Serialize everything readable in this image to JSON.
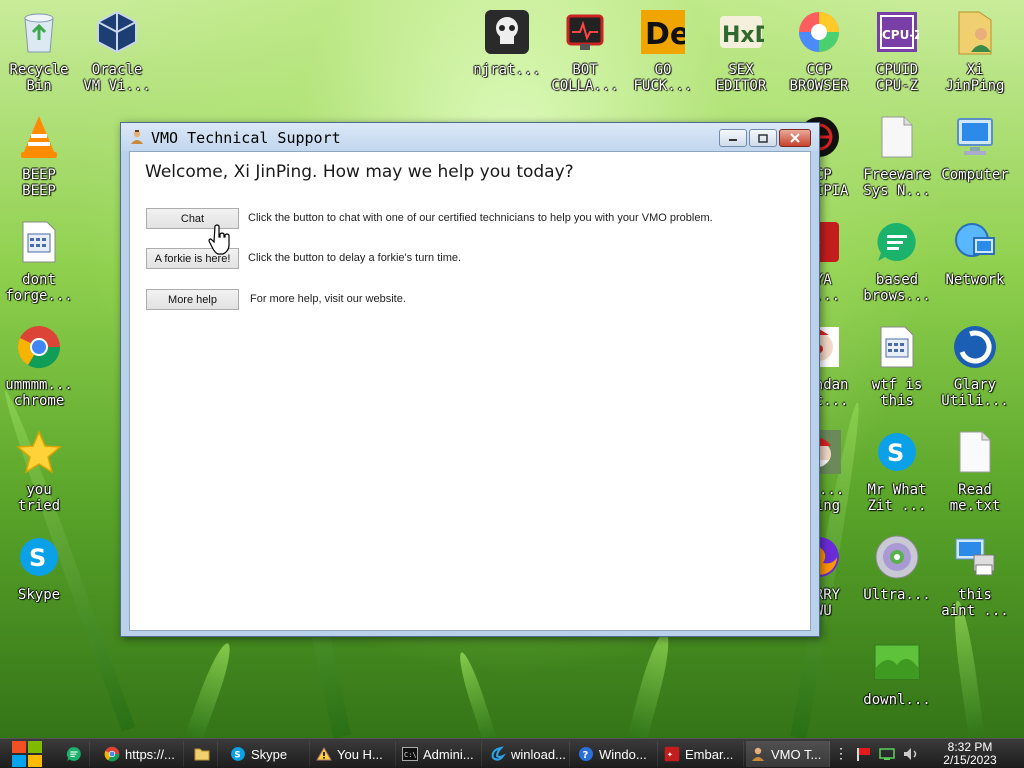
{
  "desktop": {
    "icons": [
      {
        "label": "Recycle\nBin",
        "icon": "recycle-bin-icon"
      },
      {
        "label": "Oracle\nVM Vi...",
        "icon": "virtualbox-icon"
      },
      {
        "label": "njrat...",
        "icon": "skull-icon"
      },
      {
        "label": "BOT\nCOLLA...",
        "icon": "heart-monitor-icon"
      },
      {
        "label": "GO\nFUCK...",
        "icon": "de-app-icon"
      },
      {
        "label": "SEX\nEDITOR",
        "icon": "hxd-icon"
      },
      {
        "label": "CCP\nBROWSER",
        "icon": "browser-icon"
      },
      {
        "label": "CPUID\nCPU-Z",
        "icon": "cpuz-icon"
      },
      {
        "label": "Xi\nJinPing",
        "icon": "user-folder-icon"
      },
      {
        "label": "BEEP\nBEEP",
        "icon": "vlc-icon"
      },
      {
        "label": "CCP\nWIKIPIA",
        "icon": "red-globe-icon"
      },
      {
        "label": "Freeware\nSys N...",
        "icon": "blank-document-icon"
      },
      {
        "label": "Computer",
        "icon": "computer-icon"
      },
      {
        "label": "dont\nforge...",
        "icon": "batch-file-icon"
      },
      {
        "label": "KYA\nTO...",
        "icon": "red-app-icon"
      },
      {
        "label": "based\nbrows...",
        "icon": "green-chat-icon"
      },
      {
        "label": "Network",
        "icon": "network-icon"
      },
      {
        "label": "ummmm...\nchrome",
        "icon": "chrome-icon"
      },
      {
        "label": "Grandan\nBloc...",
        "icon": "clown-icon"
      },
      {
        "label": "wtf is\nthis",
        "icon": "batch-file-icon"
      },
      {
        "label": "Glary\nUtili...",
        "icon": "glary-icon"
      },
      {
        "label": "you\ntried",
        "icon": "star-icon"
      },
      {
        "label": "Chh...\nThing",
        "icon": "santa-icon"
      },
      {
        "label": "Mr What\nZit ...",
        "icon": "skype-icon"
      },
      {
        "label": "Read\nme.txt",
        "icon": "text-file-icon"
      },
      {
        "label": "Skype",
        "icon": "skype-icon"
      },
      {
        "label": "BERRY\nUWU",
        "icon": "firefox-icon"
      },
      {
        "label": "Ultra...",
        "icon": "disc-icon"
      },
      {
        "label": "this\naint ...",
        "icon": "computer-printer-icon"
      },
      {
        "label": "downl...",
        "icon": "grass-folder-icon"
      }
    ]
  },
  "window": {
    "title": "VMO Technical Support",
    "welcome": "Welcome, Xi JinPing. How may we help you today?",
    "buttons": [
      {
        "label": "Chat",
        "description": "Click the button to chat with one of our certified technicians to help you with your VMO problem."
      },
      {
        "label": "A forkie is here!",
        "description": "Click the button to delay a forkie's turn time."
      },
      {
        "label": "More help",
        "description": "For more help, visit our website."
      }
    ]
  },
  "taskbar": {
    "items": [
      {
        "label": "",
        "icon": "green-chat-icon"
      },
      {
        "label": "https://...",
        "icon": "chrome-icon"
      },
      {
        "label": "",
        "icon": "folder-icon"
      },
      {
        "label": "Skype",
        "icon": "skype-icon"
      },
      {
        "label": "You H...",
        "icon": "warning-icon"
      },
      {
        "label": "Admini...",
        "icon": "cmd-icon"
      },
      {
        "label": "winload...",
        "icon": "ie-icon"
      },
      {
        "label": "Windo...",
        "icon": "help-icon"
      },
      {
        "label": "Embar...",
        "icon": "red-app-icon"
      },
      {
        "label": "VMO T...",
        "icon": "support-icon"
      }
    ],
    "time": "8:32 PM",
    "date": "2/15/2023"
  }
}
